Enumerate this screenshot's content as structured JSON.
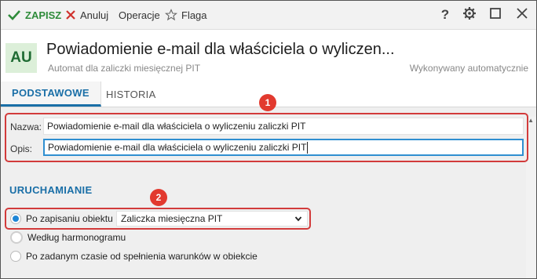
{
  "toolbar": {
    "save_label": "ZAPISZ",
    "cancel_label": "Anuluj",
    "operations_label": "Operacje",
    "flag_label": "Flaga",
    "help_icon": "?"
  },
  "header": {
    "avatar_text": "AU",
    "title": "Powiadomienie e-mail dla właściciela o wyliczen...",
    "subtitle": "Automat dla zaliczki miesięcznej PIT",
    "status": "Wykonywany automatycznie"
  },
  "tabs": [
    {
      "label": "PODSTAWOWE",
      "active": true
    },
    {
      "label": "HISTORIA",
      "active": false
    }
  ],
  "form": {
    "name_label": "Nazwa:",
    "name_value": "Powiadomienie e-mail dla właściciela o wyliczeniu zaliczki PIT",
    "desc_label": "Opis:",
    "desc_value": "Powiadomienie e-mail dla właściciela o wyliczeniu zaliczki PIT"
  },
  "trigger": {
    "section_title": "URUCHAMIANIE",
    "options": [
      {
        "label": "Po zapisaniu obiektu",
        "selected": true
      },
      {
        "label": "Według harmonogramu",
        "selected": false
      },
      {
        "label": "Po zadanym czasie od spełnienia warunków w obiekcie",
        "selected": false
      }
    ],
    "object_select_value": "Zaliczka miesięczna PIT"
  },
  "annotations": [
    "1",
    "2"
  ],
  "colors": {
    "accent": "#1a6fa7",
    "save_green": "#2e8b3a",
    "annotation_red": "#d23b3b",
    "radio_selected": "#1f86d6"
  }
}
